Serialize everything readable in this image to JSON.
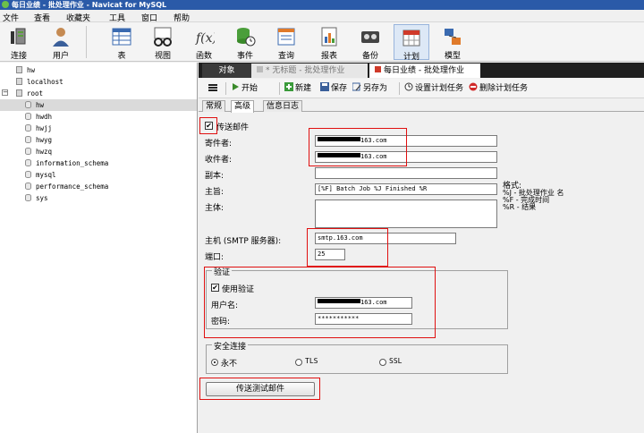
{
  "window": {
    "title": "每日业绩 - 批处理作业 - Navicat for MySQL"
  },
  "menu": [
    "文件",
    "查看",
    "收藏夹",
    "工具",
    "窗口",
    "帮助"
  ],
  "toolbar": [
    "连接",
    "用户",
    "表",
    "视图",
    "函数",
    "事件",
    "查询",
    "报表",
    "备份",
    "计划",
    "模型"
  ],
  "tree": {
    "items": [
      {
        "label": "hw",
        "type": "server"
      },
      {
        "label": "localhost",
        "type": "server"
      },
      {
        "label": "root",
        "type": "server",
        "expanded": true
      },
      {
        "label": "hw",
        "type": "db",
        "selected": true
      },
      {
        "label": "hwdh",
        "type": "db"
      },
      {
        "label": "hwjj",
        "type": "db"
      },
      {
        "label": "hwyg",
        "type": "db"
      },
      {
        "label": "hwzq",
        "type": "db"
      },
      {
        "label": "information_schema",
        "type": "db"
      },
      {
        "label": "mysql",
        "type": "db"
      },
      {
        "label": "performance_schema",
        "type": "db"
      },
      {
        "label": "sys",
        "type": "db"
      }
    ]
  },
  "tabs": {
    "objects": "对象",
    "untitled": "* 无标题 - 批处理作业",
    "current": "每日业绩 - 批处理作业"
  },
  "actions": {
    "start": "开始",
    "new": "新建",
    "save": "保存",
    "save_as": "另存为",
    "set_schedule": "设置计划任务",
    "delete_schedule": "删除计划任务"
  },
  "subtabs": [
    "常规",
    "高级",
    "信息日志"
  ],
  "form": {
    "send_email_label": "传送邮件",
    "send_email_checked": true,
    "sender_label": "寄件者:",
    "sender_value": "163.com",
    "recipient_label": "收件者:",
    "recipient_value": "163.com",
    "cc_label": "副本:",
    "cc_value": "",
    "subject_label": "主旨:",
    "subject_value": "[%F] Batch Job %J Finished %R",
    "body_label": "主体:",
    "body_value": "",
    "format_help": {
      "title": "格式:",
      "lines": [
        "%J - 批处理作业 名",
        "%F - 完成时间",
        "%R - 结果"
      ]
    },
    "host_label": "主机 (SMTP 服务器):",
    "host_value": "smtp.163.com",
    "port_label": "端口:",
    "port_value": "25",
    "auth_group": "验证",
    "use_auth_label": "使用验证",
    "use_auth_checked": true,
    "username_label": "用户名:",
    "username_value": "163.com",
    "password_label": "密码:",
    "password_value": "***********",
    "security_group": "安全连接",
    "security_options": [
      "永不",
      "TLS",
      "SSL"
    ],
    "security_selected": "永不",
    "send_test_button": "传送测试邮件"
  },
  "colors": {
    "titlebar": "#2a5aa8",
    "highlight": "#e01010",
    "tabbar": "#1f1f1f"
  }
}
